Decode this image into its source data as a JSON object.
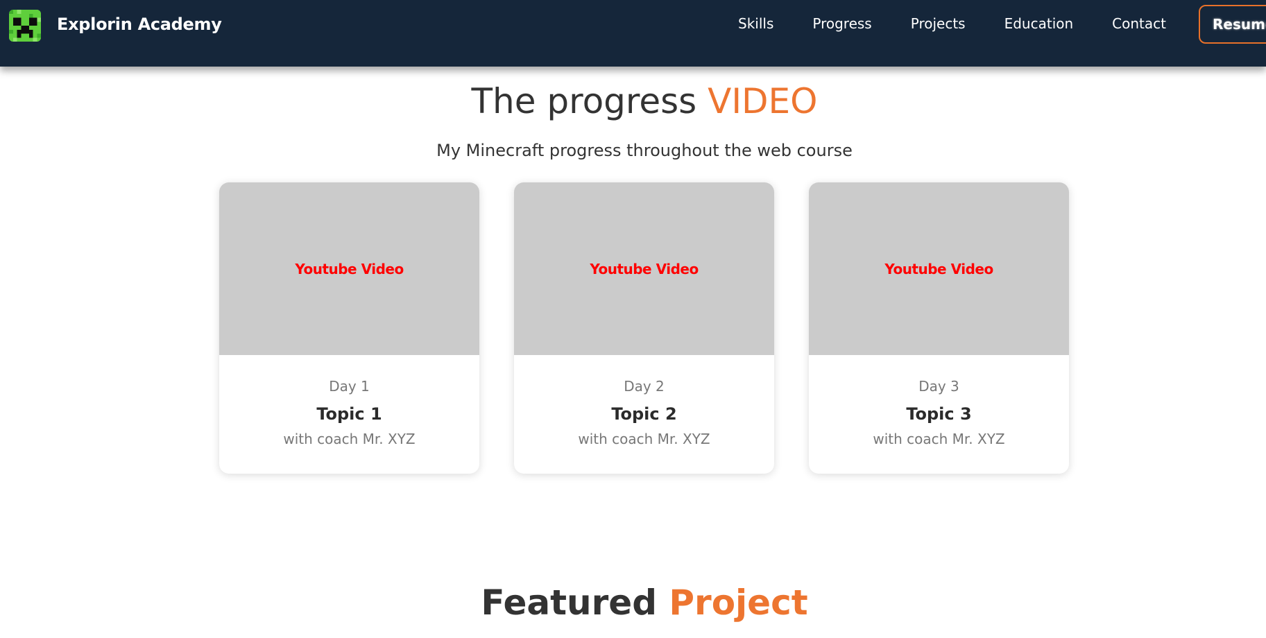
{
  "navbar": {
    "brand": "Explorin Academy",
    "links": [
      "Skills",
      "Progress",
      "Projects",
      "Education",
      "Contact"
    ],
    "resume_label": "Resume"
  },
  "progress_section": {
    "title_main": "The progress ",
    "title_accent": "VIDEO",
    "subtitle": "My Minecraft progress throughout the web course",
    "cards": [
      {
        "video_label": "Youtube Video",
        "day": "Day 1",
        "topic": "Topic 1",
        "coach": "with coach Mr. XYZ"
      },
      {
        "video_label": "Youtube Video",
        "day": "Day 2",
        "topic": "Topic 2",
        "coach": "with coach Mr. XYZ"
      },
      {
        "video_label": "Youtube Video",
        "day": "Day 3",
        "topic": "Topic 3",
        "coach": "with coach Mr. XYZ"
      }
    ]
  },
  "featured_section": {
    "title_main": "Featured ",
    "title_accent": "Project"
  },
  "colors": {
    "navbar_bg": "#15263a",
    "accent": "#ed7530",
    "video_placeholder_bg": "#cbcbcb",
    "video_label": "#ff0000"
  },
  "icons": {
    "logo": "creeper-face-icon"
  }
}
